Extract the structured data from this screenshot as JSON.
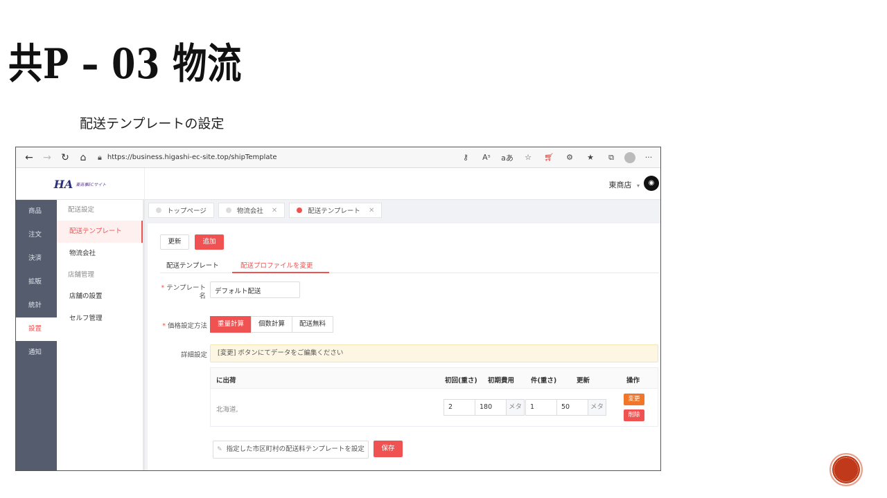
{
  "slide": {
    "title": "共P – 03 物流",
    "subtitle": "配送テンプレートの設定"
  },
  "browser": {
    "url": "https://business.higashi-ec-site.top/shipTemplate",
    "icons": [
      "back-arrow-icon",
      "forward-arrow-icon",
      "refresh-icon",
      "home-icon",
      "lock-icon",
      "key-icon",
      "read-aloud-icon",
      "translate-icon",
      "favorite-add-icon",
      "shopping-icon",
      "extensions-icon",
      "favorites-icon",
      "collections-icon",
      "profile-icon",
      "more-icon"
    ],
    "tool_labels": {
      "read_aloud": "Aˢ",
      "translate": "aあ",
      "more": "···"
    }
  },
  "header": {
    "logo_mark": "HA",
    "logo_text": "東商事ECサイト",
    "store_name": "東商店",
    "store_caret": "▾"
  },
  "main_sidebar": {
    "items": [
      "商品",
      "注文",
      "決済",
      "拡販",
      "統計",
      "設置",
      "通知"
    ],
    "active_index": 5
  },
  "sub_sidebar": {
    "group1": "配送設定",
    "item_template": "配送テンプレート",
    "item_logistics": "物流会社",
    "group2": "店舗管理",
    "item_store_settings": "店舗の設置",
    "item_self_manage": "セルフ管理"
  },
  "page_tabs": [
    {
      "label": "トップページ",
      "closable": false
    },
    {
      "label": "物流会社",
      "closable": true
    },
    {
      "label": "配送テンプレート",
      "closable": true,
      "active": true
    }
  ],
  "tab_close_glyph": "✕",
  "content": {
    "btn_refresh": "更新",
    "btn_add": "追加",
    "subtab_template": "配送テンプレート",
    "subtab_profile": "配送プロファイルを変更",
    "required_mark": "*",
    "label_template_name_a": "テンプレート",
    "label_template_name_b": "名",
    "template_name_value": "デフォルト配送",
    "label_price_method": "価格設定方法",
    "price_options": [
      "重量計算",
      "個数計算",
      "配送無料"
    ],
    "label_detail": "詳細設定",
    "notice": "[変更] ボタンにてデータをご編集ください",
    "table": {
      "headers": {
        "region": "に出荷",
        "first_weight": "初回(重さ)",
        "first_fee": "初期費用",
        "extra_weight": "件(重さ)",
        "renew": "更新",
        "ops": "操作"
      },
      "row": {
        "region": "北海道,",
        "first_weight": "2",
        "first_fee": "180",
        "unit1": "メタ",
        "extra_weight": "1",
        "renew": "50",
        "unit2": "メタ",
        "btn_edit": "変更",
        "btn_delete": "削除"
      }
    },
    "btn_set_region": "指定した市区町村の配送料テンプレートを設定",
    "btn_save": "保存"
  },
  "colors": {
    "accent": "#f05252",
    "sidebar_bg": "#545c6e",
    "edit_btn": "#f0762a",
    "notice_bg": "#fdf6e3",
    "badge": "#c0391b"
  }
}
